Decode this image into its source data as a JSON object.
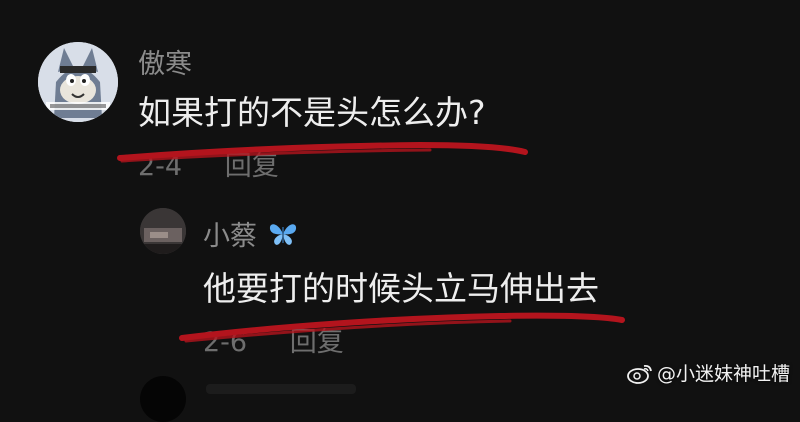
{
  "comments": [
    {
      "username": "傲寒",
      "text": "如果打的不是头怎么办?",
      "date": "2-4",
      "reply_label": "回复"
    }
  ],
  "replies": [
    {
      "username": "小蔡",
      "username_emoji": "🦋",
      "text": "他要打的时候头立马伸出去",
      "date": "2-6",
      "reply_label": "回复"
    }
  ],
  "watermark": {
    "text": "@小迷妹神吐槽",
    "icon": "weibo-icon"
  },
  "colors": {
    "background": "#111111",
    "username": "#8b8b8b",
    "comment_text": "#eeeeee",
    "meta_text": "#6e6e6e",
    "underline": "#b3141d",
    "butterfly": "#5aa9f0"
  }
}
